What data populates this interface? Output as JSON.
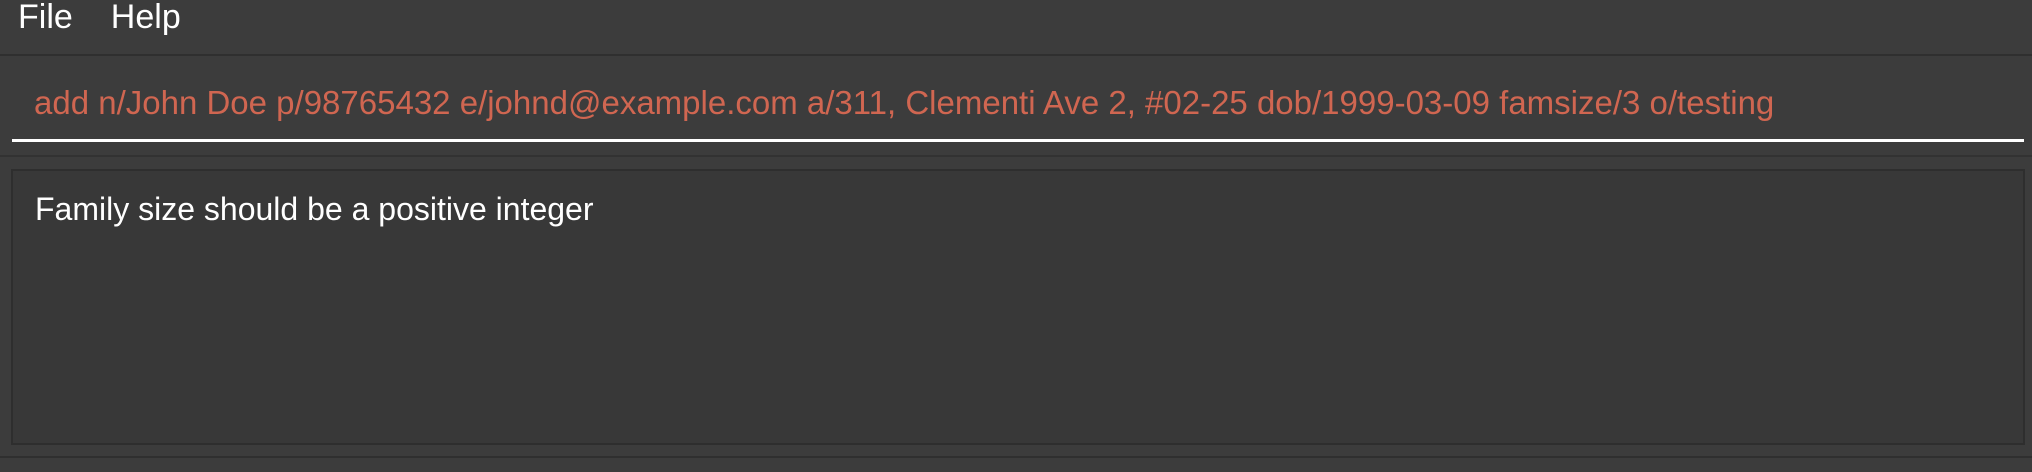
{
  "menu": {
    "items": [
      {
        "label": "File"
      },
      {
        "label": "Help"
      }
    ]
  },
  "command_box": {
    "value": "add n/John Doe p/98765432 e/johnd@example.com a/311, Clementi Ave 2, #02-25 dob/1999-03-09 famsize/3 o/testing",
    "text_color": "#d06651"
  },
  "result_display": {
    "message": "Family size should be a positive integer"
  },
  "colors": {
    "background": "#3c3c3c",
    "error_text": "#d06651",
    "text": "#ffffff"
  }
}
